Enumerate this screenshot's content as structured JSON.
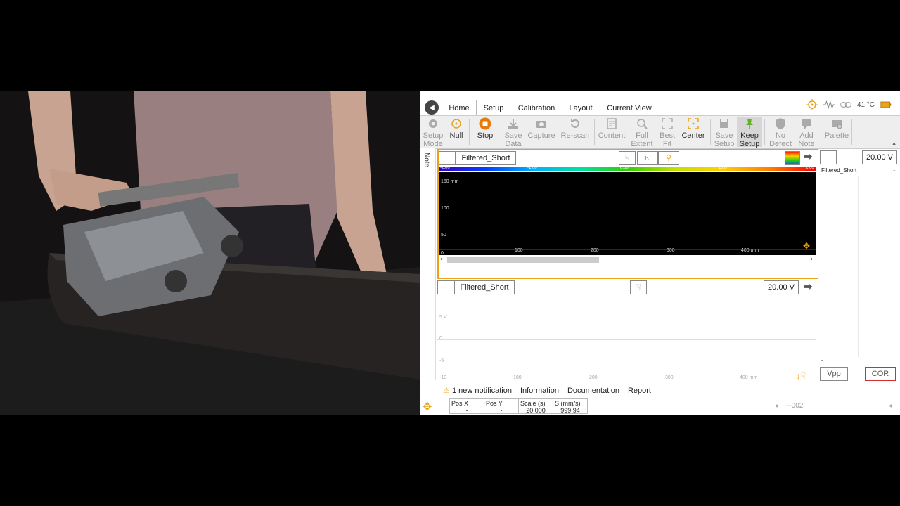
{
  "tabs": [
    {
      "label": "Home",
      "active": true
    },
    {
      "label": "Setup"
    },
    {
      "label": "Calibration"
    },
    {
      "label": "Layout"
    },
    {
      "label": "Current View"
    }
  ],
  "status": {
    "temperature": "41 °C",
    "icons": [
      "crosshair-icon",
      "signal-icon",
      "link-icon",
      "battery-icon"
    ]
  },
  "ribbon": [
    {
      "label": "Setup\nMode",
      "icon": "gear-icon"
    },
    {
      "label": "Null",
      "icon": "null-target-icon"
    },
    {
      "label": "Stop",
      "icon": "stop-icon"
    },
    {
      "label": "Save\nData",
      "icon": "save-data-icon"
    },
    {
      "label": "Capture",
      "icon": "camera-icon"
    },
    {
      "label": "Re-scan",
      "icon": "rescan-icon"
    },
    {
      "label": "Content",
      "icon": "content-icon"
    },
    {
      "label": "Full\nExtent",
      "icon": "zoom-icon"
    },
    {
      "label": "Best\nFit",
      "icon": "best-fit-icon"
    },
    {
      "label": "Center",
      "icon": "center-icon"
    },
    {
      "label": "Save\nSetup",
      "icon": "save-setup-icon"
    },
    {
      "label": "Keep\nSetup",
      "icon": "pin-icon"
    },
    {
      "label": "No\nDefect",
      "icon": "shield-icon"
    },
    {
      "label": "Add\nNote",
      "icon": "note-icon"
    },
    {
      "label": "Palette",
      "icon": "palette-icon"
    }
  ],
  "note_tab": "Note",
  "cscan": {
    "filter": "Filtered_Short",
    "colorbar_ticks": [
      "-2.00",
      "-1.00",
      "0.00",
      "1.00",
      "2.00"
    ],
    "y_ticks": [
      "150 mm",
      "100",
      "50",
      "0"
    ],
    "x_ticks": [
      "100",
      "200",
      "300",
      "400 mm"
    ]
  },
  "ascan": {
    "filter": "Filtered_Short",
    "range": "20.00 V",
    "y_ticks": [
      "5 V",
      "0",
      "-5",
      "-10"
    ],
    "x_ticks": [
      "100",
      "200",
      "300",
      "400 mm"
    ]
  },
  "side": {
    "range": "20.00 V",
    "filter": "Filtered_Short",
    "dash": "-",
    "dash2": "-",
    "vpp": "Vpp",
    "cor": "COR"
  },
  "notifications": {
    "alert": "1 new notification",
    "information": "Information",
    "documentation": "Documentation",
    "report": "Report"
  },
  "posbar": {
    "posx_label": "Pos X",
    "posx_value": "-",
    "posy_label": "Pos Y",
    "posy_value": "-",
    "scale_label": "Scale (s)",
    "scale_value": "20.000",
    "speed_label": "S (mm/s)",
    "speed_value": "999.94",
    "file_label": "--002"
  }
}
